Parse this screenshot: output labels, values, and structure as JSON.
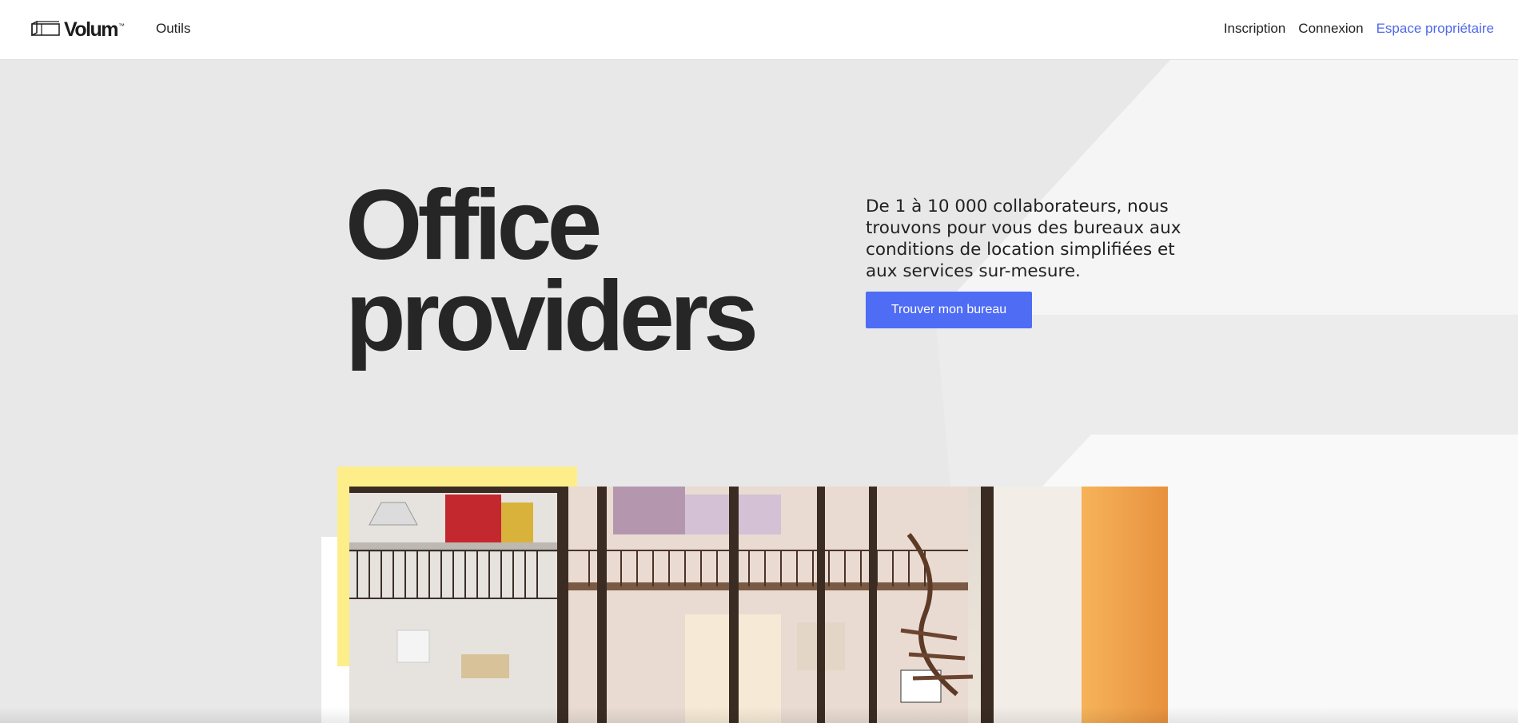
{
  "header": {
    "logo_text": "Volum",
    "logo_tm": "™",
    "nav_left": {
      "tools_label": "Outils"
    },
    "nav_right": {
      "signup_label": "Inscription",
      "login_label": "Connexion",
      "owner_label": "Espace propriétaire"
    }
  },
  "hero": {
    "title_line1": "Office",
    "title_line2": "providers",
    "description": "De 1 à 10 000 collaborateurs, nous trouvons pour vous des bureaux aux conditions de location simplifiées et aux services sur-mesure.",
    "cta_label": "Trouver mon bureau"
  },
  "icons": {
    "logo": "volum-cube-logo-icon"
  },
  "colors": {
    "accent": "#4f6cf5",
    "link_accent": "#5068e9",
    "hero_background": "#e8e8e8",
    "highlight_yellow": "#fdee8a",
    "text_dark": "#262626"
  }
}
